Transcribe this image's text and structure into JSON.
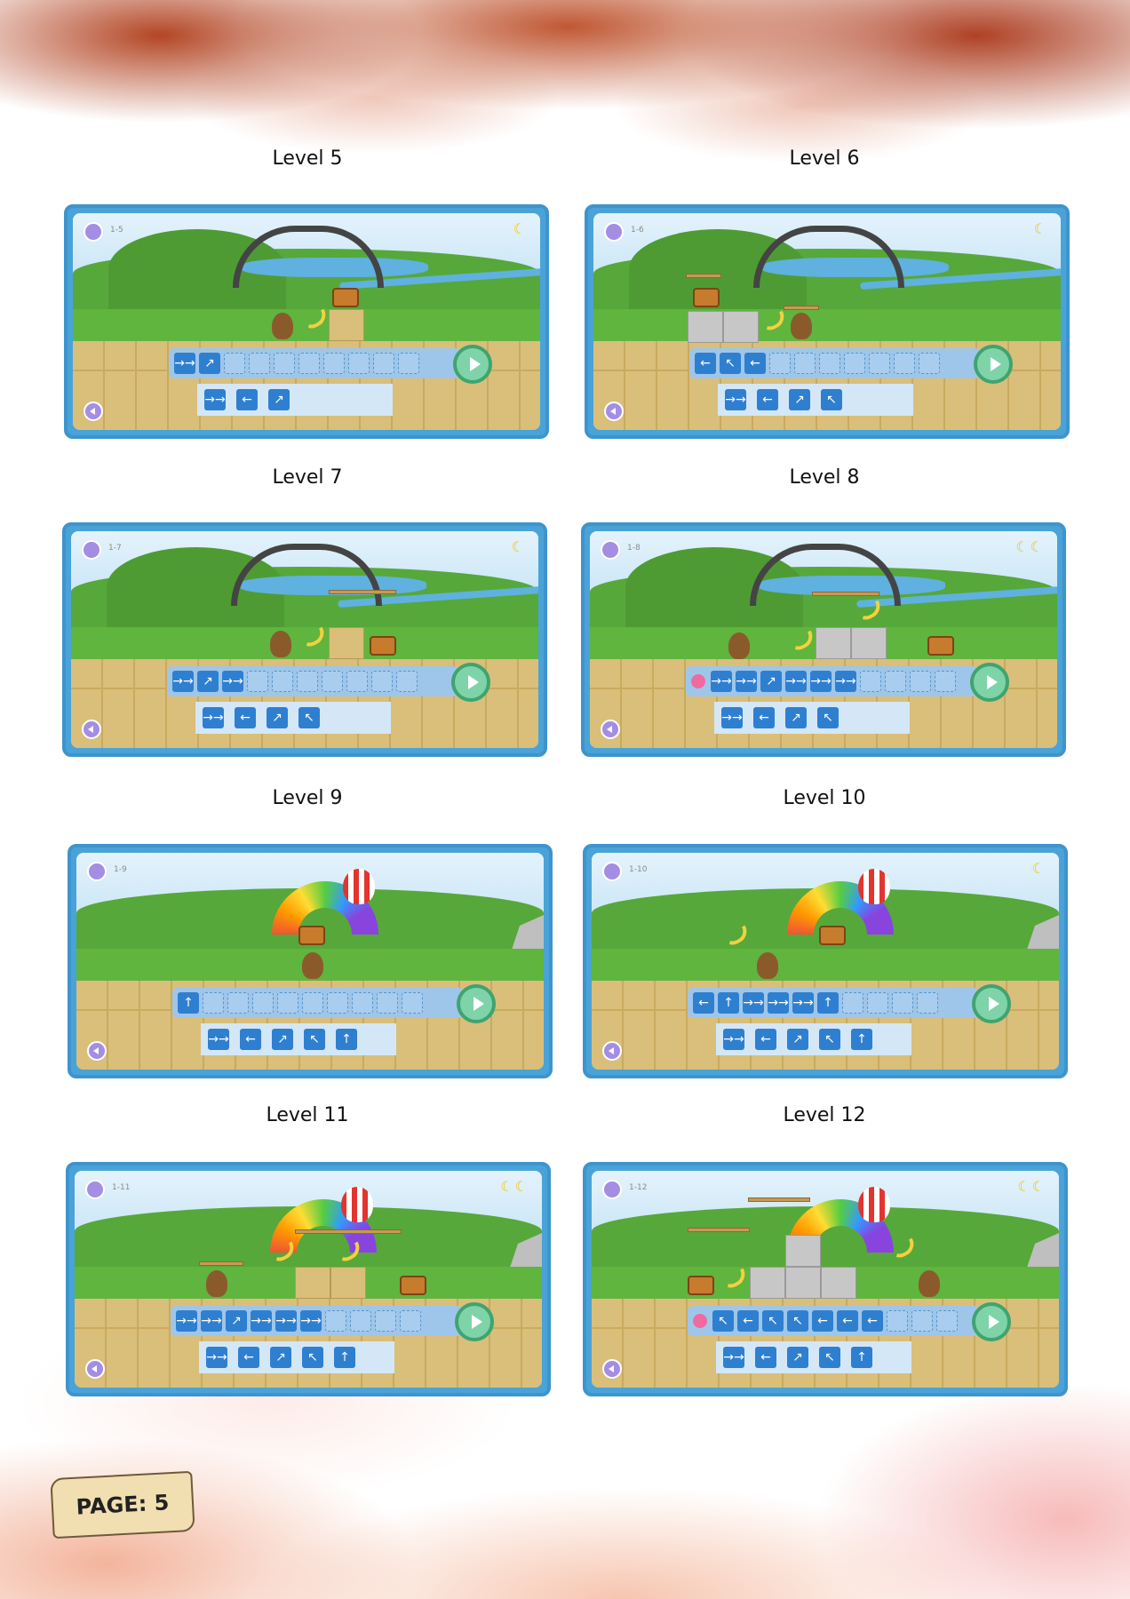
{
  "page": {
    "label": "PAGE: 5"
  },
  "levels": [
    {
      "title": "Level 5",
      "code": "1-5",
      "bananas": "☾",
      "program": [
        "→→",
        "↗"
      ],
      "palette": [
        "→→",
        "←",
        "↗"
      ]
    },
    {
      "title": "Level 6",
      "code": "1-6",
      "bananas": "☾",
      "program": [
        "←",
        "↖",
        "←"
      ],
      "palette": [
        "→→",
        "←",
        "↗",
        "↖"
      ]
    },
    {
      "title": "Level 7",
      "code": "1-7",
      "bananas": "☾",
      "program": [
        "→→",
        "↗",
        "→→"
      ],
      "palette": [
        "→→",
        "←",
        "↗",
        "↖"
      ]
    },
    {
      "title": "Level 8",
      "code": "1-8",
      "bananas": "☾☾",
      "program": [
        "→→",
        "→→",
        "↗",
        "→→",
        "→→",
        "→→"
      ],
      "palette": [
        "→→",
        "←",
        "↗",
        "↖"
      ]
    },
    {
      "title": "Level 9",
      "code": "1-9",
      "bananas": "",
      "program": [
        "↑"
      ],
      "palette": [
        "→→",
        "←",
        "↗",
        "↖",
        "↑"
      ]
    },
    {
      "title": "Level 10",
      "code": "1-10",
      "bananas": "☾",
      "program": [
        "←",
        "↑",
        "→→",
        "→→",
        "→→",
        "↑"
      ],
      "palette": [
        "→→",
        "←",
        "↗",
        "↖",
        "↑"
      ]
    },
    {
      "title": "Level 11",
      "code": "1-11",
      "bananas": "☾☾",
      "program": [
        "→→",
        "→→",
        "↗",
        "→→",
        "→→",
        "→→"
      ],
      "palette": [
        "→→",
        "←",
        "↗",
        "↖",
        "↑"
      ]
    },
    {
      "title": "Level 12",
      "code": "1-12",
      "bananas": "☾☾",
      "program": [
        "↖",
        "←",
        "↖",
        "↖",
        "←",
        "←",
        "←"
      ],
      "palette": [
        "→→",
        "←",
        "↗",
        "↖",
        "↑"
      ]
    }
  ],
  "colors": {
    "command": "#2f7fd1",
    "play": "#7fd3a8",
    "frame": "#4aa3d8"
  },
  "icons": {
    "menu": "levels-menu-icon",
    "sound": "speaker-icon",
    "play": "play-icon",
    "rewind": "rewind-icon"
  }
}
